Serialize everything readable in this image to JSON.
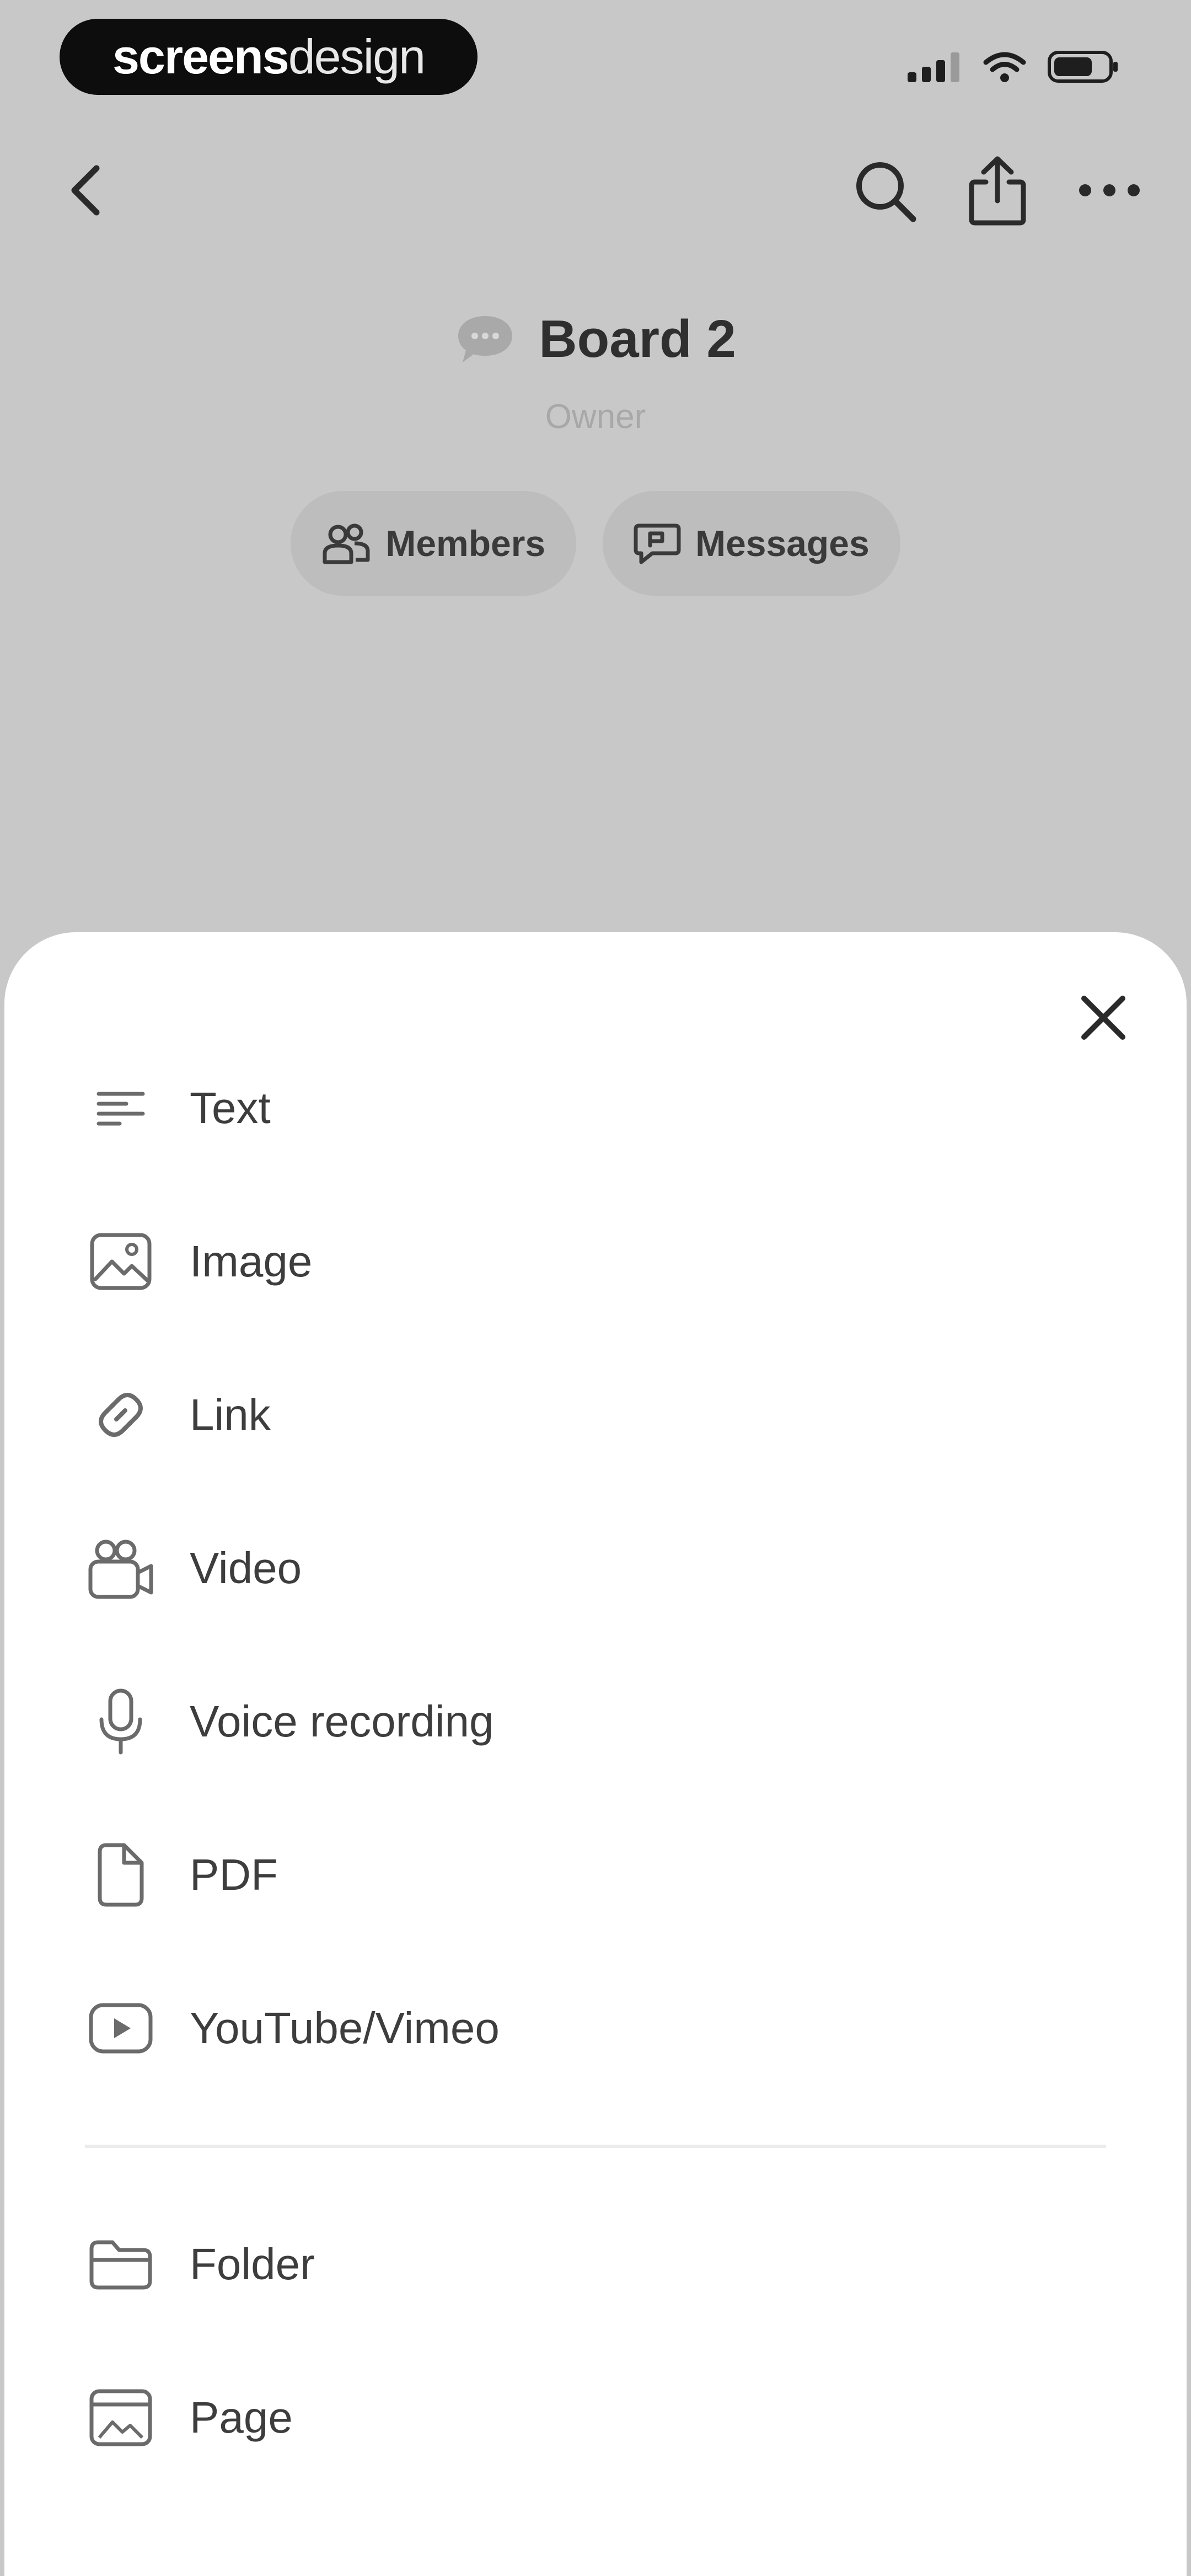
{
  "status_bar": {
    "brand_bold": "screens",
    "brand_light": "design",
    "icons": [
      "signal-icon",
      "wifi-icon",
      "battery-icon"
    ]
  },
  "nav": {
    "icons": [
      "back-icon",
      "search-icon",
      "share-icon",
      "more-icon"
    ]
  },
  "board": {
    "icon": "speech-bubble-icon",
    "title": "Board 2",
    "role": "Owner",
    "pills": [
      {
        "label": "Members",
        "icon": "members-icon"
      },
      {
        "label": "Messages",
        "icon": "messages-icon"
      }
    ]
  },
  "sheet": {
    "close_icon": "close-icon",
    "items": [
      {
        "label": "Text",
        "icon": "text-icon"
      },
      {
        "label": "Image",
        "icon": "image-icon"
      },
      {
        "label": "Link",
        "icon": "link-icon"
      },
      {
        "label": "Video",
        "icon": "video-icon"
      },
      {
        "label": "Voice recording",
        "icon": "microphone-icon"
      },
      {
        "label": "PDF",
        "icon": "document-icon"
      },
      {
        "label": "YouTube/Vimeo",
        "icon": "play-icon"
      }
    ],
    "secondary_items": [
      {
        "label": "Folder",
        "icon": "folder-icon"
      },
      {
        "label": "Page",
        "icon": "page-icon"
      }
    ]
  },
  "colors": {
    "backdrop": "#c8c8c8",
    "sheet": "#ffffff",
    "text_primary": "#3d3d3d",
    "text_muted": "#a8a8a8",
    "pill_bg": "#bdbdbd",
    "brand_pill": "#0d0d0d"
  }
}
